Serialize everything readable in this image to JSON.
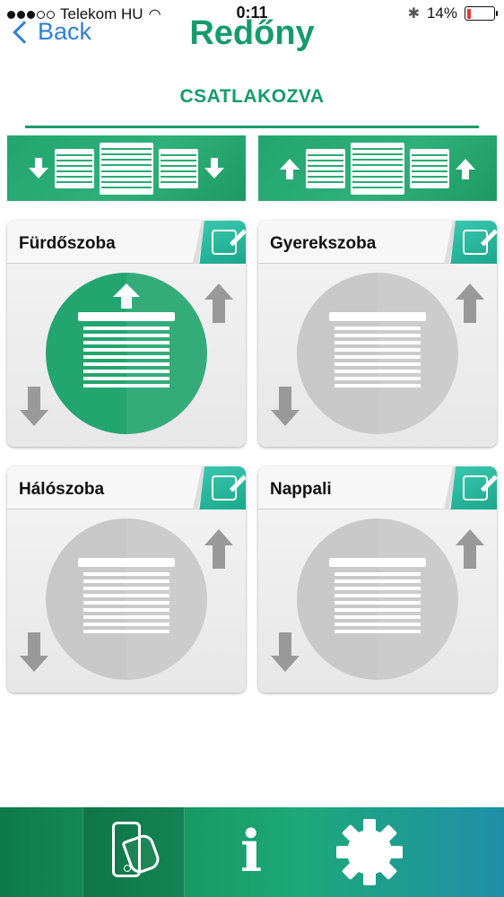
{
  "status_bar": {
    "carrier": "Telekom HU",
    "time": "0:11",
    "battery_percent": "14%",
    "battery_level": 0.14,
    "battery_color": "#e53935"
  },
  "nav": {
    "back_label": "Back",
    "title": "Redőny"
  },
  "connection_status": "CSATLAKOZVA",
  "colors": {
    "brand_green": "#169b6b",
    "active_circle": "#23a56f",
    "inactive_circle": "#c8c8c8",
    "back_blue": "#2f7fd6",
    "edit_teal": "#1aa88c"
  },
  "all_controls": [
    {
      "name": "all-down-button",
      "icon": "arrow-down-icon"
    },
    {
      "name": "all-up-button",
      "icon": "arrow-up-icon"
    }
  ],
  "rooms": [
    {
      "name": "Fürdőszoba",
      "active": true
    },
    {
      "name": "Gyerekszoba",
      "active": false
    },
    {
      "name": "Hálószoba",
      "active": false
    },
    {
      "name": "Nappali",
      "active": false
    }
  ],
  "tab_bar": {
    "tabs": [
      {
        "icon": "touch-phone-icon",
        "selected": true
      },
      {
        "icon": "info-icon",
        "glyph": "i",
        "selected": false
      },
      {
        "icon": "gear-icon",
        "selected": false
      }
    ]
  }
}
